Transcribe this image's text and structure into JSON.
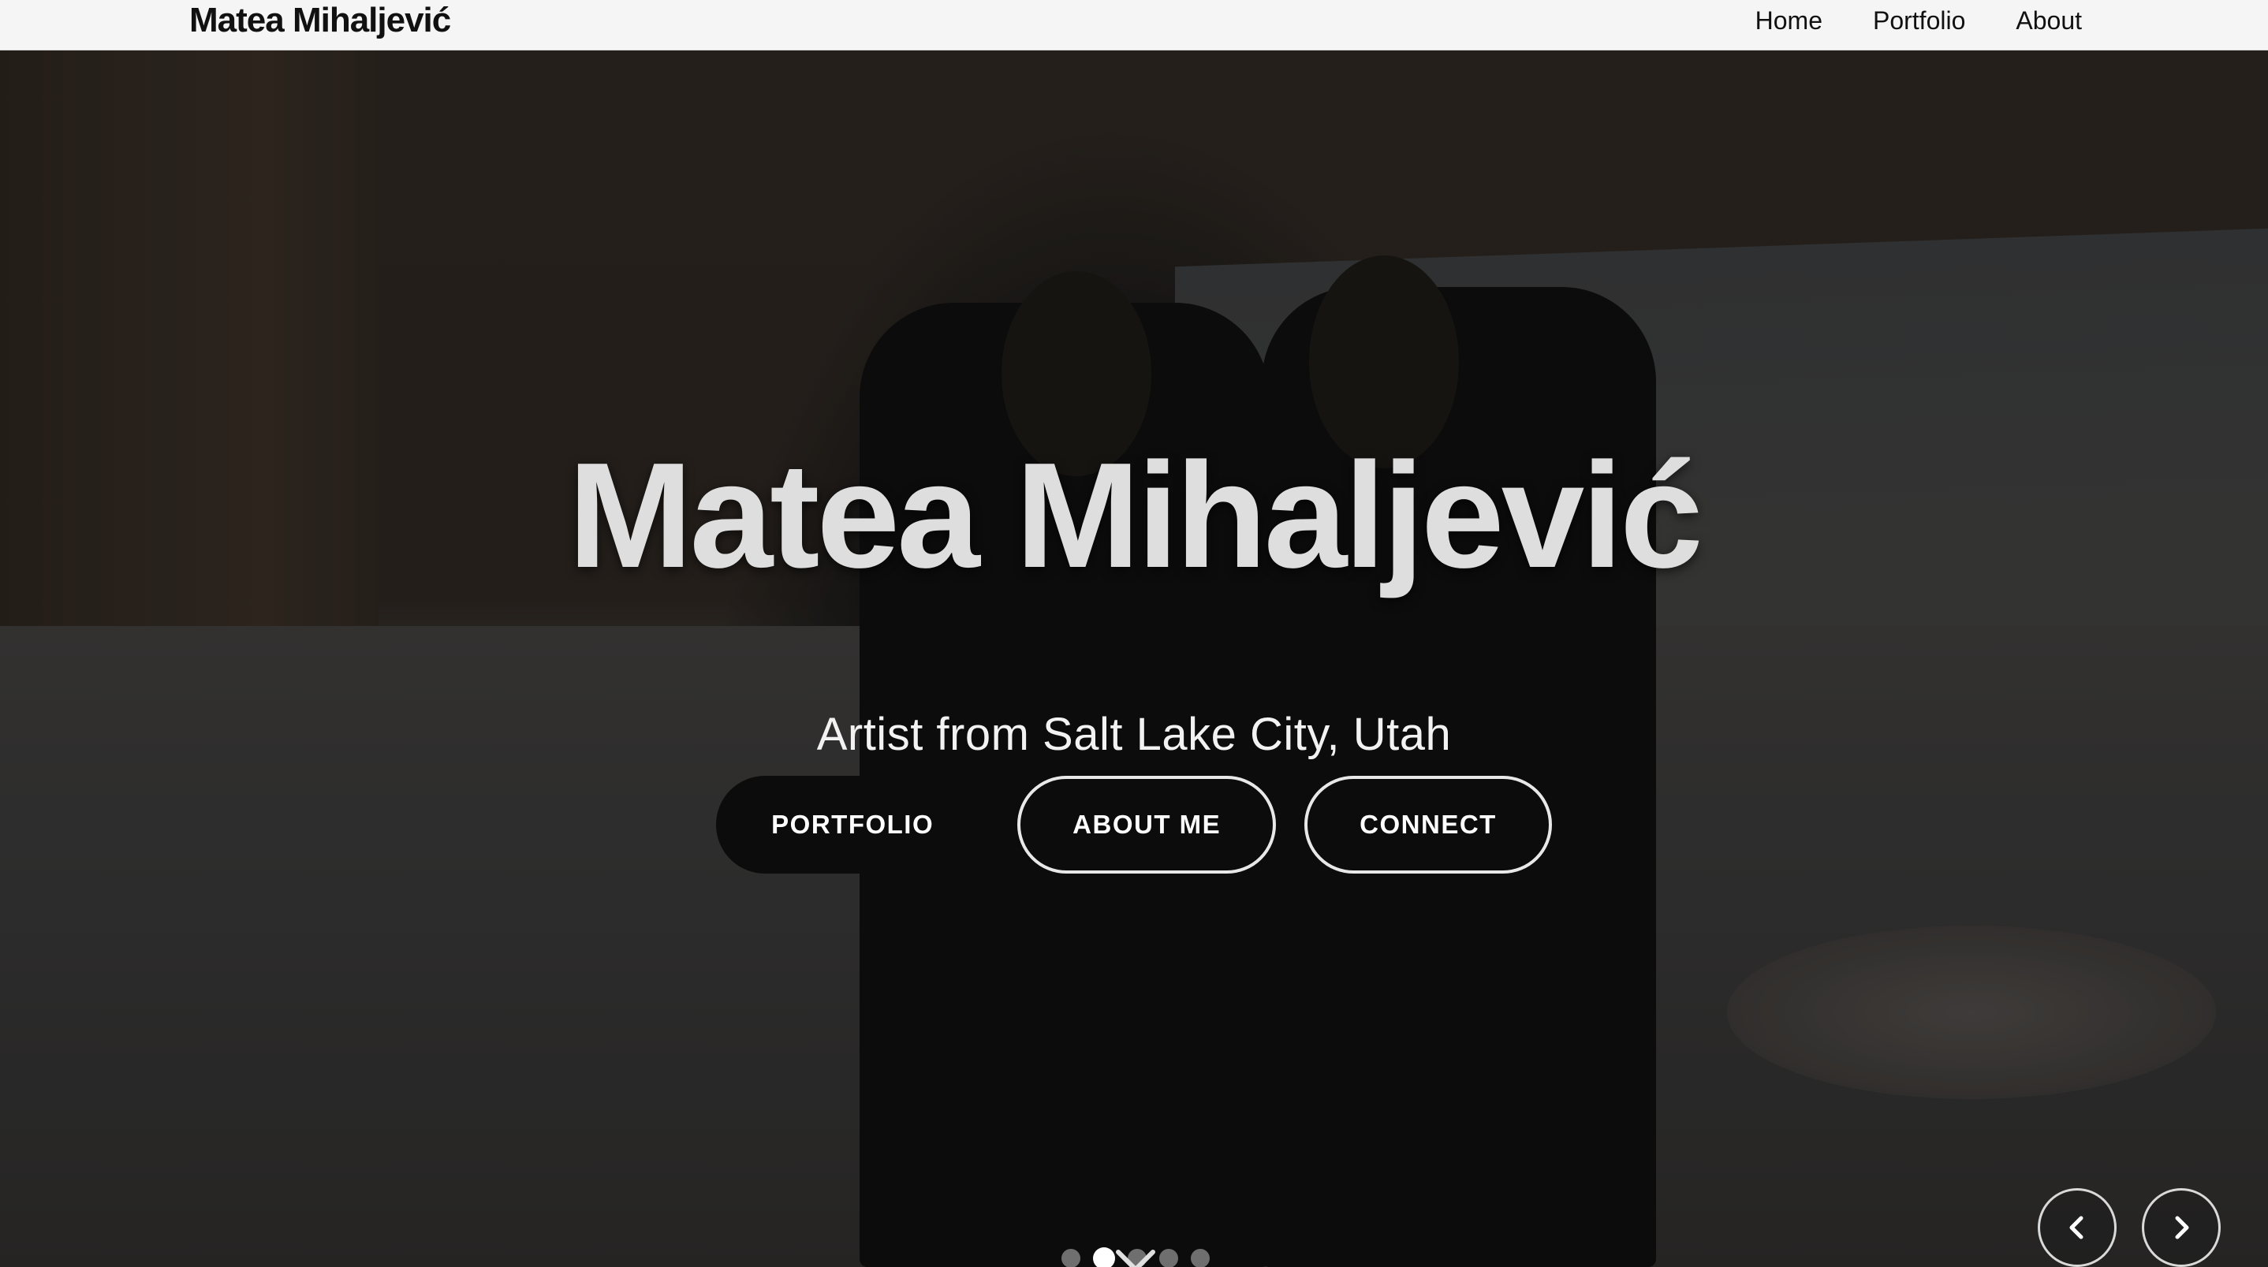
{
  "navbar": {
    "brand": "Matea Mihaljević",
    "links": [
      "Home",
      "Portfolio",
      "About"
    ]
  },
  "hero": {
    "title": "Matea Mihaljević",
    "subtitle": "Artist from Salt Lake City, Utah",
    "buttons": {
      "portfolio": "PORTFOLIO",
      "about": "ABOUT ME",
      "connect": "CONNECT"
    }
  },
  "carousel": {
    "slide_count": 5,
    "active_index": 1,
    "icons": {
      "prev": "chevron-left-icon",
      "next": "chevron-right-icon",
      "scroll": "chevron-down-icon"
    }
  },
  "colors": {
    "navbar_bg": "#f5f5f5",
    "solid_button_bg": "#0c0c0c",
    "hero_title": "#dedede"
  }
}
